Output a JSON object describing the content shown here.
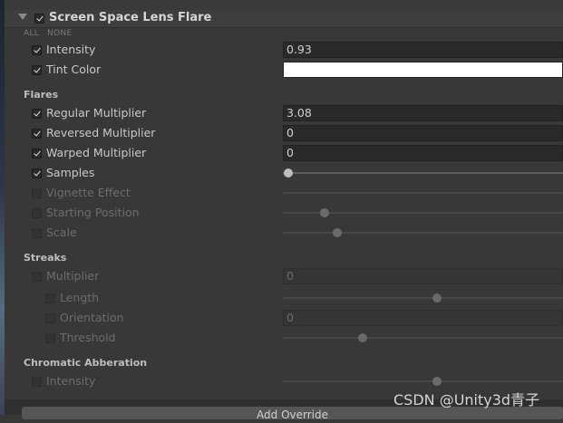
{
  "panel": {
    "title": "Screen Space Lens Flare",
    "all_label": "ALL",
    "none_label": "NONE",
    "add_override_label": "Add Override"
  },
  "rows": {
    "intensity": {
      "label": "Intensity",
      "value": "0.93",
      "checked": true
    },
    "tint_color": {
      "label": "Tint Color",
      "color": "#ffffff",
      "checked": true
    },
    "flares_section": "Flares",
    "regular_multiplier": {
      "label": "Regular Multiplier",
      "value": "3.08",
      "checked": true
    },
    "reversed_multiplier": {
      "label": "Reversed Multiplier",
      "value": "0",
      "checked": true
    },
    "warped_multiplier": {
      "label": "Warped Multiplier",
      "value": "0",
      "checked": true
    },
    "samples": {
      "label": "Samples",
      "checked": true,
      "slider_fraction": 0.02
    },
    "vignette_effect": {
      "label": "Vignette Effect",
      "checked": false
    },
    "starting_position": {
      "label": "Starting Position",
      "checked": false,
      "slider_fraction": 0.15
    },
    "scale": {
      "label": "Scale",
      "checked": false,
      "slider_fraction": 0.195
    },
    "streaks_section": "Streaks",
    "streaks_multiplier": {
      "label": "Multiplier",
      "value": "0",
      "checked": false
    },
    "length": {
      "label": "Length",
      "checked": false,
      "slider_fraction": 0.55
    },
    "orientation": {
      "label": "Orientation",
      "value": "0",
      "checked": false
    },
    "threshold": {
      "label": "Threshold",
      "checked": false,
      "slider_fraction": 0.285
    },
    "chromatic_section": "Chromatic Abberation",
    "chromatic_intensity": {
      "label": "Intensity",
      "checked": false,
      "slider_fraction": 0.55
    }
  },
  "watermark": "CSDN @Unity3d青子"
}
